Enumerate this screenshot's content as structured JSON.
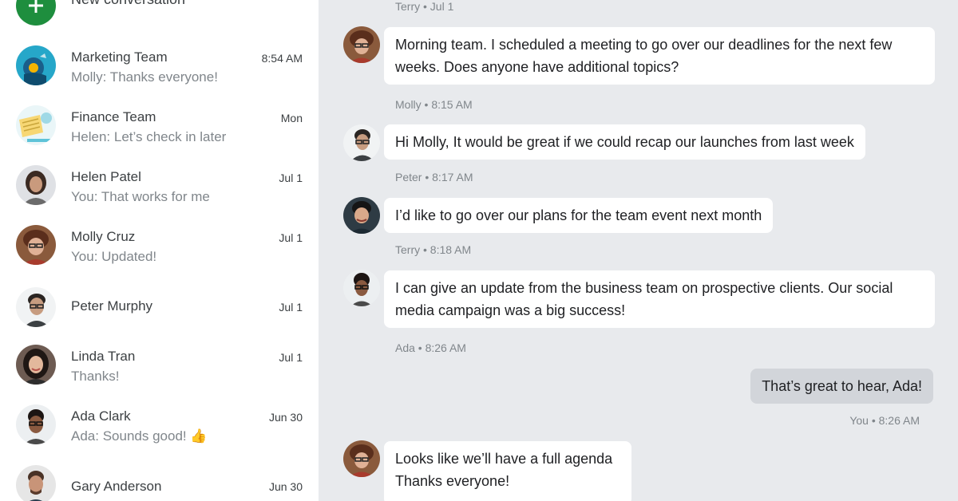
{
  "sidebar": {
    "new_conversation": "New conversation",
    "conversations": [
      {
        "name": "Marketing Team",
        "snippet": "Molly: Thanks everyone!",
        "time": "8:54 AM"
      },
      {
        "name": "Finance Team",
        "snippet": "Helen: Let’s check in later",
        "time": "Mon"
      },
      {
        "name": "Helen Patel",
        "snippet": "You: That works for me",
        "time": "Jul 1"
      },
      {
        "name": "Molly Cruz",
        "snippet": "You: Updated!",
        "time": "Jul 1"
      },
      {
        "name": "Peter Murphy",
        "snippet": "",
        "time": "Jul 1"
      },
      {
        "name": "Linda Tran",
        "snippet": "Thanks!",
        "time": "Jul 1"
      },
      {
        "name": "Ada Clark",
        "snippet": "Ada: Sounds good! 👍",
        "time": "Jun 30"
      },
      {
        "name": "Gary Anderson",
        "snippet": "",
        "time": "Jun 30"
      }
    ]
  },
  "chat": {
    "messages": [
      {
        "meta": "Terry • Jul 1"
      },
      {
        "text": "Morning team. I scheduled a meeting to go over our deadlines for the next few weeks. Does anyone have additional topics?",
        "meta": "Molly • 8:15 AM"
      },
      {
        "text": "Hi Molly, It would be great if we could recap our launches from last week",
        "meta": "Peter • 8:17 AM"
      },
      {
        "text": "I’d like to go over our plans for the team event next month",
        "meta": "Terry • 8:18 AM"
      },
      {
        "text": "I can give an update from the business team on prospective clients. Our social media campaign was a big success!",
        "meta": "Ada • 8:26 AM"
      },
      {
        "text": "That’s great to hear, Ada!",
        "meta": "You • 8:26 AM"
      },
      {
        "text": "Looks like we’ll have a full agenda Thanks everyone!"
      }
    ]
  },
  "colors": {
    "fab": "#1e8e3e",
    "chat_bg": "#e8eaed",
    "outgoing_bubble": "#d2d5da"
  }
}
